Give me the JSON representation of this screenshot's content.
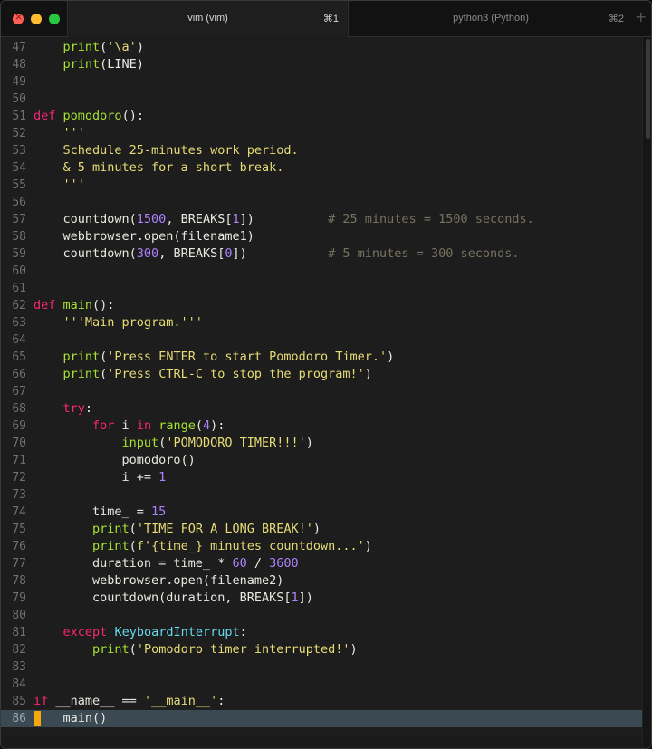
{
  "window": {
    "traffic_lights": [
      "close",
      "minimize",
      "maximize"
    ],
    "colors": {
      "close": "#ff5f57",
      "minimize": "#febc2e",
      "maximize": "#28c840"
    }
  },
  "tabs": [
    {
      "title": "vim (vim)",
      "shortcut": "⌘1",
      "active": true
    },
    {
      "title": "python3 (Python)",
      "shortcut": "⌘2",
      "active": false
    }
  ],
  "new_tab_icon": "+",
  "theme": {
    "keyword": "#f92672",
    "function": "#a6e22e",
    "string": "#e6db74",
    "number": "#ae81ff",
    "comment": "#75715e",
    "class": "#66d9ef",
    "cursor": "#f5a80a",
    "cursorline": "#3b4a52"
  },
  "editor": {
    "mode": "vim",
    "cursor_line": "86",
    "lines": [
      {
        "n": "47",
        "t": [
          [
            "",
            "    "
          ],
          [
            "fn",
            "print"
          ],
          [
            "",
            "("
          ],
          [
            "s",
            "'\\a'"
          ],
          [
            "",
            ")"
          ]
        ]
      },
      {
        "n": "48",
        "t": [
          [
            "",
            "    "
          ],
          [
            "fn",
            "print"
          ],
          [
            "",
            "(LINE)"
          ]
        ]
      },
      {
        "n": "49",
        "t": []
      },
      {
        "n": "50",
        "t": []
      },
      {
        "n": "51",
        "t": [
          [
            "k",
            "def"
          ],
          [
            "",
            " "
          ],
          [
            "fn",
            "pomodoro"
          ],
          [
            "",
            "():"
          ]
        ]
      },
      {
        "n": "52",
        "t": [
          [
            "s",
            "    '''"
          ]
        ]
      },
      {
        "n": "53",
        "t": [
          [
            "s",
            "    Schedule 25-minutes work period."
          ]
        ]
      },
      {
        "n": "54",
        "t": [
          [
            "s",
            "    & 5 minutes for a short break."
          ]
        ]
      },
      {
        "n": "55",
        "t": [
          [
            "s",
            "    '''"
          ]
        ]
      },
      {
        "n": "56",
        "t": []
      },
      {
        "n": "57",
        "t": [
          [
            "",
            "    countdown("
          ],
          [
            "n",
            "1500"
          ],
          [
            "",
            ", BREAKS["
          ],
          [
            "n",
            "1"
          ],
          [
            "",
            "])          "
          ],
          [
            "c",
            "# 25 minutes = 1500 seconds."
          ]
        ]
      },
      {
        "n": "58",
        "t": [
          [
            "",
            "    webbrowser.open(filename1)"
          ]
        ]
      },
      {
        "n": "59",
        "t": [
          [
            "",
            "    countdown("
          ],
          [
            "n",
            "300"
          ],
          [
            "",
            ", BREAKS["
          ],
          [
            "n",
            "0"
          ],
          [
            "",
            "])           "
          ],
          [
            "c",
            "# 5 minutes = 300 seconds."
          ]
        ]
      },
      {
        "n": "60",
        "t": []
      },
      {
        "n": "61",
        "t": []
      },
      {
        "n": "62",
        "t": [
          [
            "k",
            "def"
          ],
          [
            "",
            " "
          ],
          [
            "fn",
            "main"
          ],
          [
            "",
            "():"
          ]
        ]
      },
      {
        "n": "63",
        "t": [
          [
            "s",
            "    '''Main program.'''"
          ]
        ]
      },
      {
        "n": "64",
        "t": []
      },
      {
        "n": "65",
        "t": [
          [
            "",
            "    "
          ],
          [
            "fn",
            "print"
          ],
          [
            "",
            "("
          ],
          [
            "s",
            "'Press ENTER to start Pomodoro Timer.'"
          ],
          [
            "",
            ")"
          ]
        ]
      },
      {
        "n": "66",
        "t": [
          [
            "",
            "    "
          ],
          [
            "fn",
            "print"
          ],
          [
            "",
            "("
          ],
          [
            "s",
            "'Press CTRL-C to stop the program!'"
          ],
          [
            "",
            ")"
          ]
        ]
      },
      {
        "n": "67",
        "t": []
      },
      {
        "n": "68",
        "t": [
          [
            "",
            "    "
          ],
          [
            "k",
            "try"
          ],
          [
            "",
            ":"
          ]
        ]
      },
      {
        "n": "69",
        "t": [
          [
            "",
            "        "
          ],
          [
            "k",
            "for"
          ],
          [
            "",
            " i "
          ],
          [
            "k",
            "in"
          ],
          [
            "",
            " "
          ],
          [
            "fn",
            "range"
          ],
          [
            "",
            "("
          ],
          [
            "n",
            "4"
          ],
          [
            "",
            "):"
          ]
        ]
      },
      {
        "n": "70",
        "t": [
          [
            "",
            "            "
          ],
          [
            "fn",
            "input"
          ],
          [
            "",
            "("
          ],
          [
            "s",
            "'POMODORO TIMER!!!'"
          ],
          [
            "",
            ")"
          ]
        ]
      },
      {
        "n": "71",
        "t": [
          [
            "",
            "            pomodoro()"
          ]
        ]
      },
      {
        "n": "72",
        "t": [
          [
            "",
            "            i += "
          ],
          [
            "n",
            "1"
          ]
        ]
      },
      {
        "n": "73",
        "t": []
      },
      {
        "n": "74",
        "t": [
          [
            "",
            "        time_ = "
          ],
          [
            "n",
            "15"
          ]
        ]
      },
      {
        "n": "75",
        "t": [
          [
            "",
            "        "
          ],
          [
            "fn",
            "print"
          ],
          [
            "",
            "("
          ],
          [
            "s",
            "'TIME FOR A LONG BREAK!'"
          ],
          [
            "",
            ")"
          ]
        ]
      },
      {
        "n": "76",
        "t": [
          [
            "",
            "        "
          ],
          [
            "fn",
            "print"
          ],
          [
            "",
            "("
          ],
          [
            "s",
            "f'{time_} minutes countdown...'"
          ],
          [
            "",
            ")"
          ]
        ]
      },
      {
        "n": "77",
        "t": [
          [
            "",
            "        duration = time_ * "
          ],
          [
            "n",
            "60"
          ],
          [
            "",
            " / "
          ],
          [
            "n",
            "3600"
          ]
        ]
      },
      {
        "n": "78",
        "t": [
          [
            "",
            "        webbrowser.open(filename2)"
          ]
        ]
      },
      {
        "n": "79",
        "t": [
          [
            "",
            "        countdown(duration, BREAKS["
          ],
          [
            "n",
            "1"
          ],
          [
            "",
            "])"
          ]
        ]
      },
      {
        "n": "80",
        "t": []
      },
      {
        "n": "81",
        "t": [
          [
            "",
            "    "
          ],
          [
            "k",
            "except"
          ],
          [
            "",
            " "
          ],
          [
            "cls",
            "KeyboardInterrupt"
          ],
          [
            "",
            ":"
          ]
        ]
      },
      {
        "n": "82",
        "t": [
          [
            "",
            "        "
          ],
          [
            "fn",
            "print"
          ],
          [
            "",
            "("
          ],
          [
            "s",
            "'Pomodoro timer interrupted!'"
          ],
          [
            "",
            ")"
          ]
        ]
      },
      {
        "n": "83",
        "t": []
      },
      {
        "n": "84",
        "t": []
      },
      {
        "n": "85",
        "t": [
          [
            "k",
            "if"
          ],
          [
            "",
            " __name__ == "
          ],
          [
            "s",
            "'__main__'"
          ],
          [
            "",
            ":"
          ]
        ]
      },
      {
        "n": "86",
        "t": [
          [
            "",
            "    main()"
          ]
        ]
      }
    ]
  }
}
